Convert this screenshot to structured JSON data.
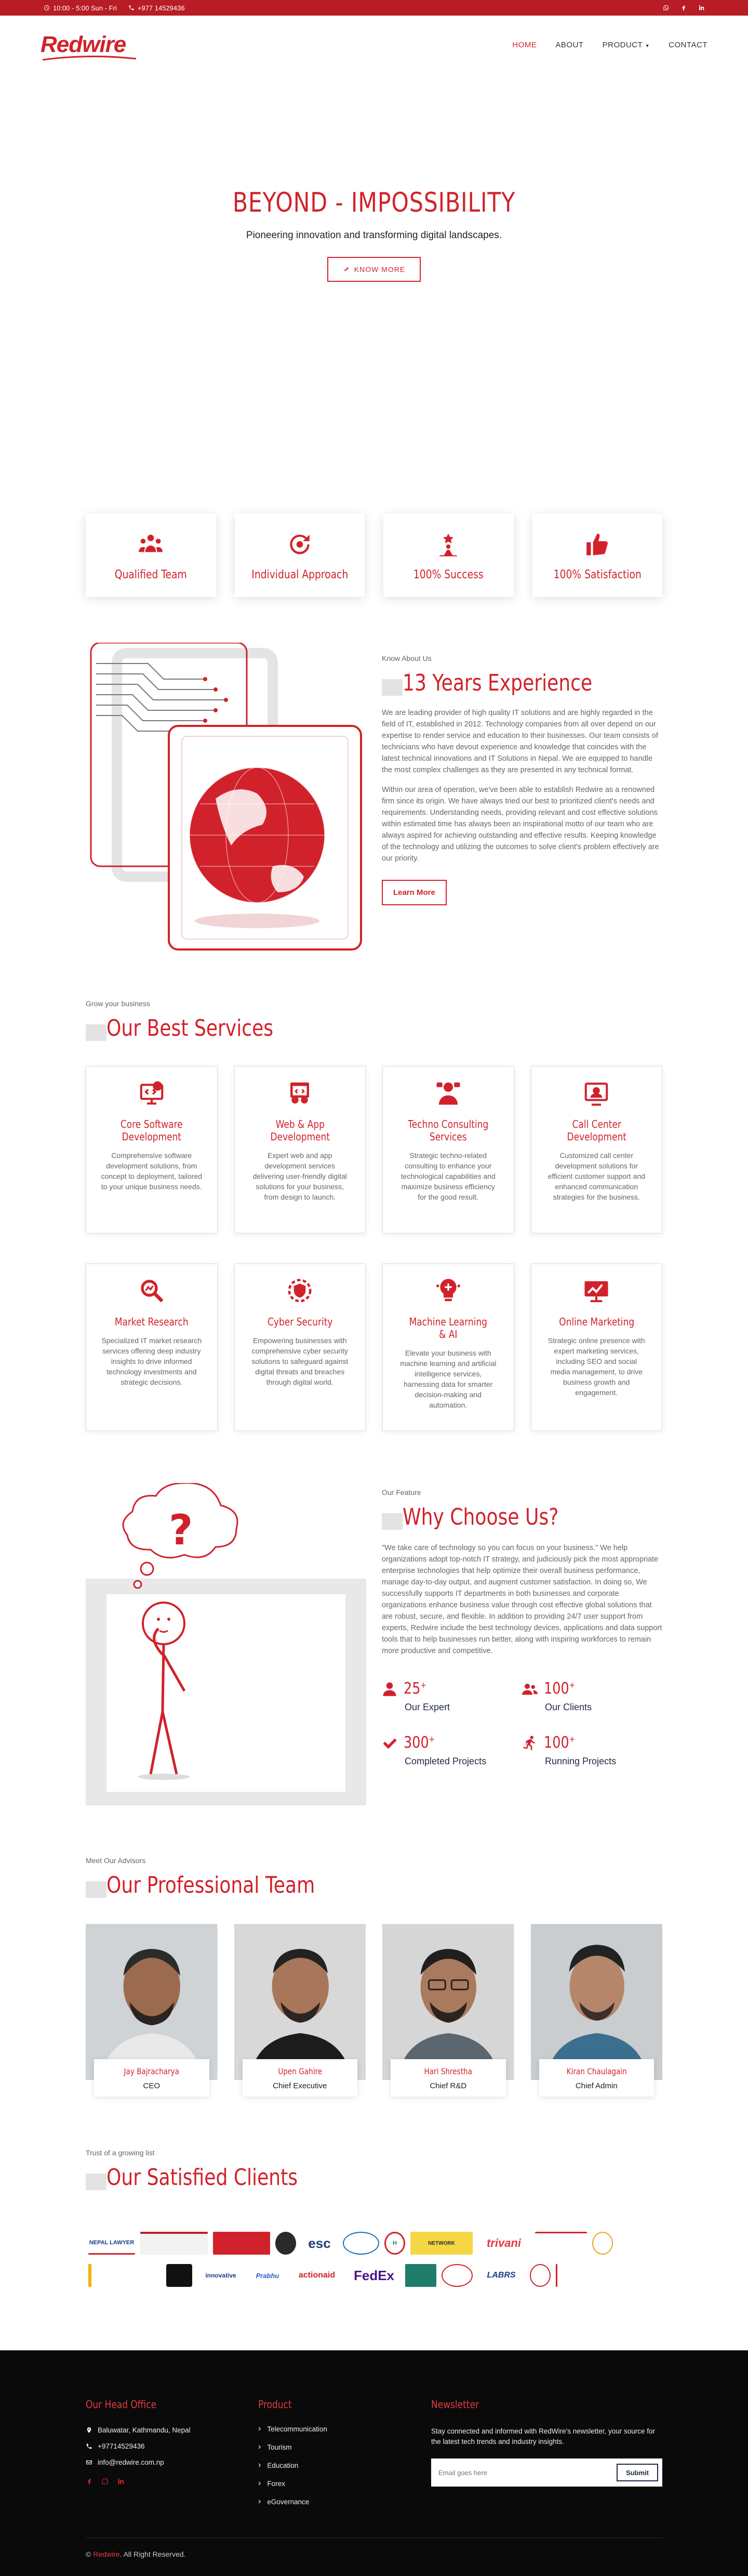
{
  "topbar": {
    "hours": "10:00 - 5:00 Sun - Fri",
    "phone": "+977 14529436"
  },
  "brand": {
    "logo": "Redwire",
    "accent": "#d1222b"
  },
  "nav": {
    "home": "HOME",
    "about": "ABOUT",
    "product": "PRODUCT",
    "contact": "CONTACT"
  },
  "hero": {
    "title": "BEYOND - IMPOSSIBILITY",
    "subtitle": "Pioneering innovation and transforming digital landscapes.",
    "button": "KNOW MORE"
  },
  "features": [
    {
      "label": "Qualified Team",
      "icon": "team-icon"
    },
    {
      "label": "Individual Approach",
      "icon": "approach-icon"
    },
    {
      "label": "100% Success",
      "icon": "success-icon"
    },
    {
      "label": "100% Satisfaction",
      "icon": "thumbs-up-icon"
    }
  ],
  "about": {
    "eyebrow": "Know About Us",
    "title": "13 Years Experience",
    "p1": "We are leading provider of high quality IT solutions and are highly regarded in the field of IT, established in 2012. Technology companies from all over depend on our expertise to render service and education to their businesses. Our team consists of technicians who have devout experience and knowledge that coincides with the latest technical innovations and IT Solutions in Nepal. We are equipped to handle the most complex challenges as they are presented in any technical format.",
    "p2": "Within our area of operation, we've been able to establish Redwire as a renowned firm since its origin. We have always tried our best to prioritized client's needs and requirements. Understanding needs, providing relevant and cost effective solutions within estimated time has always been an inspirational motto of our team who are always aspired for achieving outstanding and effective results. Keeping knowledge of the technology and utilizing the outcomes to solve client's problem effectively are our priority.",
    "button": "Learn More"
  },
  "services": {
    "eyebrow": "Grow your business",
    "title": "Our Best Services",
    "items": [
      {
        "title": "Core Software Development",
        "desc": "Comprehensive software development solutions, from concept to deployment, tailored to your unique business needs.",
        "icon": "software-icon"
      },
      {
        "title": "Web & App Development",
        "desc": "Expert web and app development services delivering user-friendly digital solutions for your business, from design to launch.",
        "icon": "web-app-icon"
      },
      {
        "title": "Techno Consulting Services",
        "desc": "Strategic techno-related consulting to enhance your technological capabilities and maximize business efficiency for the good result.",
        "icon": "consulting-icon"
      },
      {
        "title": "Call Center Development",
        "desc": "Customized call center development solutions for efficient customer support and enhanced communication strategies for the business.",
        "icon": "call-center-icon"
      },
      {
        "title": "Market Research",
        "desc": "Specialized IT market research services offering deep industry insights to drive informed technology investments and strategic decisions.",
        "icon": "research-icon"
      },
      {
        "title": "Cyber Security",
        "desc": "Empowering businesses with comprehensive cyber security solutions to safeguard against digital threats and breaches through digital world.",
        "icon": "security-icon"
      },
      {
        "title": "Machine Learning & AI",
        "desc": "Elevate your business with machine learning and artificial intelligence services, harnessing data for smarter decision-making and automation.",
        "icon": "ai-icon"
      },
      {
        "title": "Online Marketing",
        "desc": "Strategic online presence with expert marketing services, including SEO and social media management, to drive business growth and engagement.",
        "icon": "marketing-icon"
      }
    ]
  },
  "why": {
    "eyebrow": "Our Feature",
    "title": "Why Choose Us?",
    "text": "\"We take care of technology so you can focus on your business.\" We help organizations adopt top-notch IT strategy, and judiciously pick the most appropriate enterprise technologies that help optimize their overall business performance, manage day-to-day output, and augment customer satisfaction. In doing so, We successfully supports IT departments in both businesses and corporate organizations enhance business value through cost effective global solutions that are robust, secure, and flexible. In addition to providing 24/7 user support from experts, Redwire include the best technology devices, applications and data support tools that to help businesses run better, along with inspiring workforces to remain more productive and competitive.",
    "stats": [
      {
        "value": "25",
        "label": "Our Expert",
        "icon": "user-icon"
      },
      {
        "value": "100",
        "label": "Our Clients",
        "icon": "users-icon"
      },
      {
        "value": "300",
        "label": "Completed Projects",
        "icon": "check-icon"
      },
      {
        "value": "100",
        "label": "Running Projects",
        "icon": "running-icon"
      }
    ]
  },
  "team": {
    "eyebrow": "Meet Our Advisors",
    "title": "Our Professional Team",
    "members": [
      {
        "name": "Jay Bajracharya",
        "role": "CEO"
      },
      {
        "name": "Upen Gahire",
        "role": "Chief Executive"
      },
      {
        "name": "Hari Shrestha",
        "role": "Chief R&D"
      },
      {
        "name": "Kiran Chaulagain",
        "role": "Chief Admin"
      }
    ]
  },
  "clients": {
    "eyebrow": "Trust of a growing list",
    "title": "Our Satisfied Clients",
    "row1": [
      "NEPAL LAWYER",
      "",
      "",
      "",
      "esc",
      "",
      "",
      "NETWORK",
      "trivani",
      ""
    ],
    "row2": [
      "",
      "",
      "innovative",
      "Prabhu",
      "actionaid",
      "FedEx",
      "",
      "",
      "LABRS",
      "",
      ""
    ]
  },
  "footer": {
    "office_title": "Our Head Office",
    "address": "Baluwatar, Kathmandu, Nepal",
    "phone": "+97714529436",
    "email": "info@redwire.com.np",
    "product_title": "Product",
    "products": [
      "Telecommunication",
      "Tourism",
      "Education",
      "Forex",
      "eGovernance"
    ],
    "news_title": "Newsletter",
    "news_text": "Stay connected and informed with RedWire's newsletter, your source for the latest tech trends and industry insights.",
    "news_placeholder": "Email goes here",
    "news_button": "Submit",
    "copyright_brand": "Redwire",
    "copyright_rest": ". All Right Reserved."
  }
}
